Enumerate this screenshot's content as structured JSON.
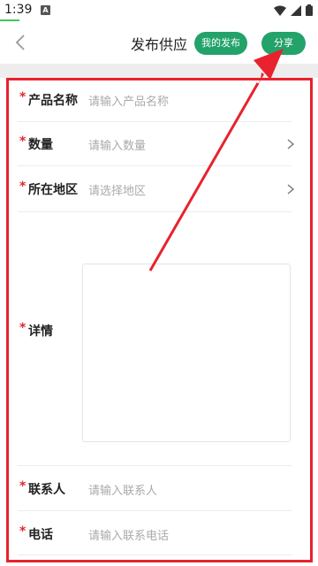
{
  "status": {
    "time": "1:39",
    "notification_icon": "A"
  },
  "header": {
    "back_icon": "chevron-left-icon",
    "title": "发布供应",
    "my_posts_label": "我的发布",
    "share_label": "分享",
    "accent_color": "#23a26a"
  },
  "form": {
    "required_mark": "*",
    "fields": [
      {
        "label": "产品名称",
        "placeholder": "请输入产品名称",
        "has_chevron": false
      },
      {
        "label": "数量",
        "placeholder": "请输入数量",
        "has_chevron": true
      },
      {
        "label": "所在地区",
        "placeholder": "请选择地区",
        "has_chevron": true
      },
      {
        "label": "详情",
        "placeholder": "",
        "has_chevron": false
      },
      {
        "label": "联系人",
        "placeholder": "请输入联系人",
        "has_chevron": false
      },
      {
        "label": "电话",
        "placeholder": "请输入联系电话",
        "has_chevron": false
      }
    ]
  },
  "annotation": {
    "color": "#e8222e",
    "type": "arrow-pointing-to-share-button"
  }
}
